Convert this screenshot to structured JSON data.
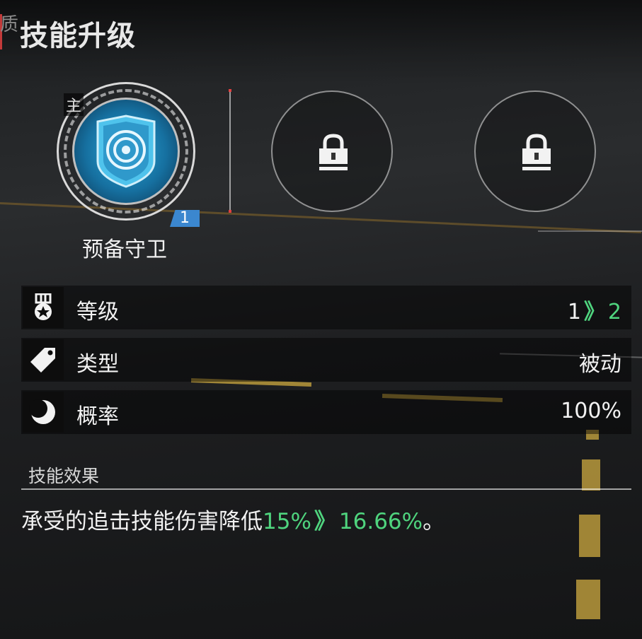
{
  "window": {
    "title": "技能升级",
    "corner_glyph": "质"
  },
  "skills": {
    "main": {
      "tag": "主",
      "level_badge": "1",
      "name": "预备守卫",
      "icon": "shield-target-icon"
    },
    "locked_slots": [
      {
        "icon": "lock-icon"
      },
      {
        "icon": "lock-icon"
      }
    ]
  },
  "stats": [
    {
      "icon": "medal-icon",
      "label": "等级",
      "value_from": "1",
      "arrow": "》",
      "value_to": "2"
    },
    {
      "icon": "tag-icon",
      "label": "类型",
      "value": "被动"
    },
    {
      "icon": "moon-icon",
      "label": "概率",
      "value": "100%"
    }
  ],
  "effects": {
    "header": "技能效果",
    "prefix": "承受的追击技能伤害降低",
    "from": "15%",
    "arrow": "》",
    "to": "16.66%",
    "suffix": "。"
  },
  "colors": {
    "accent_green": "#4fd47e",
    "badge_blue": "#3b87cf",
    "shield_blue": "#2aa6d6",
    "marker_red": "#c23a3a"
  }
}
